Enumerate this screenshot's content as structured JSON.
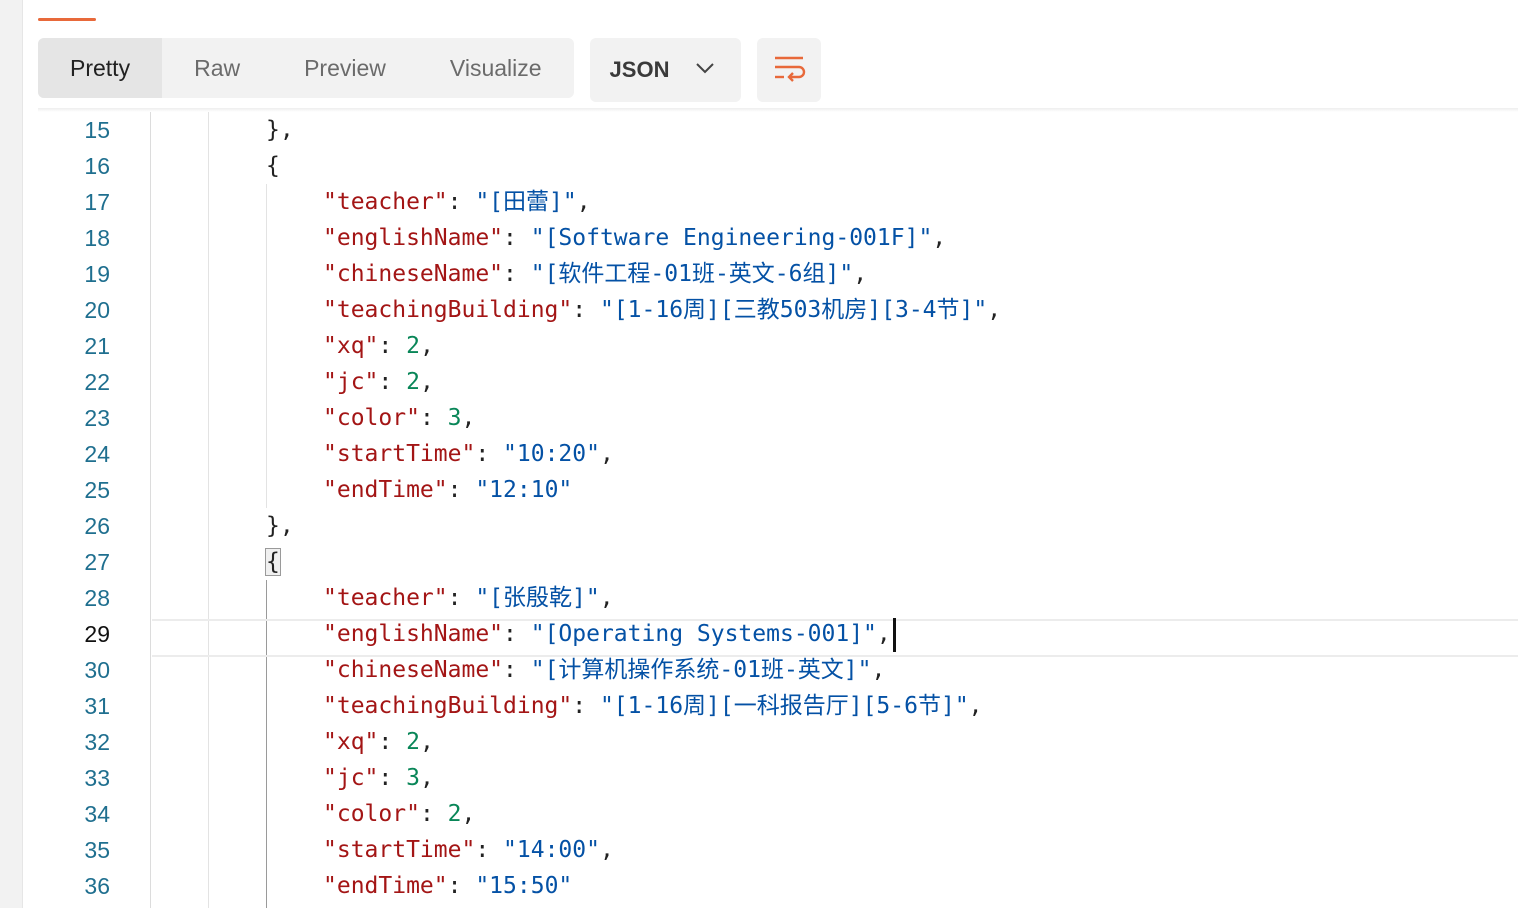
{
  "response_tabs": {
    "items": [
      {
        "label": "Pretty"
      },
      {
        "label": "Raw"
      },
      {
        "label": "Preview"
      },
      {
        "label": "Visualize"
      }
    ],
    "selected": "Pretty"
  },
  "format": {
    "label": "JSON",
    "icon": "chevron-down-icon"
  },
  "wrap_button": {
    "icon": "wrap-lines-icon"
  },
  "colors": {
    "accent": "#e8693a",
    "key": "#a31515",
    "string": "#0451a5",
    "number": "#098658",
    "line_number": "#1f6f8f"
  },
  "editor": {
    "current_line": "29",
    "lines": [
      {
        "num": "15",
        "kind": "close",
        "text": "},"
      },
      {
        "num": "16",
        "kind": "open",
        "text": "{"
      },
      {
        "num": "17",
        "kind": "str",
        "key": "\"teacher\"",
        "value": "\"[田蕾]\"",
        "comma": ","
      },
      {
        "num": "18",
        "kind": "str",
        "key": "\"englishName\"",
        "value": "\"[Software Engineering-001F]\"",
        "comma": ","
      },
      {
        "num": "19",
        "kind": "str",
        "key": "\"chineseName\"",
        "value": "\"[软件工程-01班-英文-6组]\"",
        "comma": ","
      },
      {
        "num": "20",
        "kind": "str",
        "key": "\"teachingBuilding\"",
        "value": "\"[1-16周][三教503机房][3-4节]\"",
        "comma": ","
      },
      {
        "num": "21",
        "kind": "num",
        "key": "\"xq\"",
        "value": "2",
        "comma": ","
      },
      {
        "num": "22",
        "kind": "num",
        "key": "\"jc\"",
        "value": "2",
        "comma": ","
      },
      {
        "num": "23",
        "kind": "num",
        "key": "\"color\"",
        "value": "3",
        "comma": ","
      },
      {
        "num": "24",
        "kind": "str",
        "key": "\"startTime\"",
        "value": "\"10:20\"",
        "comma": ","
      },
      {
        "num": "25",
        "kind": "str",
        "key": "\"endTime\"",
        "value": "\"12:10\"",
        "comma": ""
      },
      {
        "num": "26",
        "kind": "close",
        "text": "},"
      },
      {
        "num": "27",
        "kind": "open",
        "text": "{"
      },
      {
        "num": "28",
        "kind": "str",
        "key": "\"teacher\"",
        "value": "\"[张殷乾]\"",
        "comma": ","
      },
      {
        "num": "29",
        "kind": "str",
        "key": "\"englishName\"",
        "value": "\"[Operating Systems-001]\"",
        "comma": ","
      },
      {
        "num": "30",
        "kind": "str",
        "key": "\"chineseName\"",
        "value": "\"[计算机操作系统-01班-英文]\"",
        "comma": ","
      },
      {
        "num": "31",
        "kind": "str",
        "key": "\"teachingBuilding\"",
        "value": "\"[1-16周][一科报告厅][5-6节]\"",
        "comma": ","
      },
      {
        "num": "32",
        "kind": "num",
        "key": "\"xq\"",
        "value": "2",
        "comma": ","
      },
      {
        "num": "33",
        "kind": "num",
        "key": "\"jc\"",
        "value": "3",
        "comma": ","
      },
      {
        "num": "34",
        "kind": "num",
        "key": "\"color\"",
        "value": "2",
        "comma": ","
      },
      {
        "num": "35",
        "kind": "str",
        "key": "\"startTime\"",
        "value": "\"14:00\"",
        "comma": ","
      },
      {
        "num": "36",
        "kind": "str",
        "key": "\"endTime\"",
        "value": "\"15:50\"",
        "comma": ""
      }
    ]
  }
}
